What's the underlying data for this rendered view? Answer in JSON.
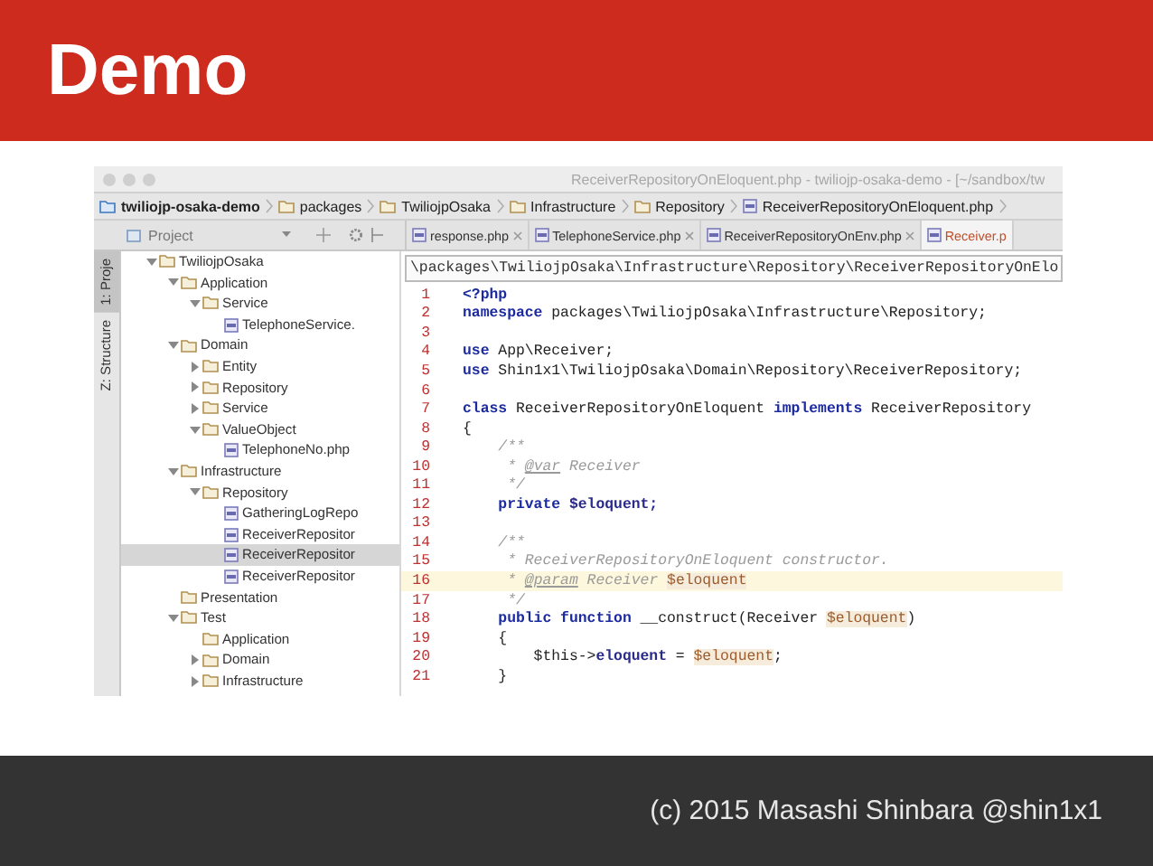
{
  "slide": {
    "title": "Demo",
    "footer": "(c) 2015 Masashi Shinbara @shin1x1"
  },
  "ide": {
    "window_title": "ReceiverRepositoryOnEloquent.php - twiliojp-osaka-demo - [~/sandbox/tw",
    "breadcrumbs": [
      {
        "label": "twiliojp-osaka-demo",
        "kind": "project"
      },
      {
        "label": "packages",
        "kind": "folder"
      },
      {
        "label": "TwiliojpOsaka",
        "kind": "folder"
      },
      {
        "label": "Infrastructure",
        "kind": "folder"
      },
      {
        "label": "Repository",
        "kind": "folder"
      },
      {
        "label": "ReceiverRepositoryOnEloquent.php",
        "kind": "file"
      }
    ],
    "project_panel": {
      "label": "Project"
    },
    "tool_tabs": [
      {
        "label": "1: Proje",
        "selected": true
      },
      {
        "label": "Z: Structure",
        "selected": false
      }
    ],
    "editor_tabs": [
      {
        "label": "response.php",
        "selected": false
      },
      {
        "label": "TelephoneService.php",
        "selected": false
      },
      {
        "label": "ReceiverRepositoryOnEnv.php",
        "selected": false
      },
      {
        "label": "Receiver.p",
        "selected": true
      }
    ],
    "path": "\\packages\\TwiliojpOsaka\\Infrastructure\\Repository\\ReceiverRepositoryOnElo",
    "tree": [
      {
        "label": "TwiliojpOsaka",
        "kind": "folder",
        "expanded": true,
        "selected": false,
        "children": [
          {
            "label": "Application",
            "kind": "folder",
            "expanded": true,
            "selected": false,
            "children": [
              {
                "label": "Service",
                "kind": "folder",
                "expanded": true,
                "selected": false,
                "children": [
                  {
                    "label": "TelephoneService.",
                    "kind": "file",
                    "selected": false
                  }
                ]
              }
            ]
          },
          {
            "label": "Domain",
            "kind": "folder",
            "expanded": true,
            "selected": false,
            "children": [
              {
                "label": "Entity",
                "kind": "folder",
                "expanded": false,
                "selected": false
              },
              {
                "label": "Repository",
                "kind": "folder",
                "expanded": false,
                "selected": false
              },
              {
                "label": "Service",
                "kind": "folder",
                "expanded": false,
                "selected": false
              },
              {
                "label": "ValueObject",
                "kind": "folder",
                "expanded": true,
                "selected": false,
                "children": [
                  {
                    "label": "TelephoneNo.php",
                    "kind": "file",
                    "selected": false
                  }
                ]
              }
            ]
          },
          {
            "label": "Infrastructure",
            "kind": "folder",
            "expanded": true,
            "selected": false,
            "children": [
              {
                "label": "Repository",
                "kind": "folder",
                "expanded": true,
                "selected": false,
                "children": [
                  {
                    "label": "GatheringLogRepo",
                    "kind": "file",
                    "selected": false
                  },
                  {
                    "label": "ReceiverRepositor",
                    "kind": "file",
                    "selected": false
                  },
                  {
                    "label": "ReceiverRepositor",
                    "kind": "file",
                    "selected": true
                  },
                  {
                    "label": "ReceiverRepositor",
                    "kind": "file",
                    "selected": false
                  }
                ]
              }
            ]
          },
          {
            "label": "Presentation",
            "kind": "folder",
            "selected": false
          },
          {
            "label": "Test",
            "kind": "folder",
            "expanded": true,
            "selected": false,
            "children": [
              {
                "label": "Application",
                "kind": "folder",
                "selected": false
              },
              {
                "label": "Domain",
                "kind": "folder",
                "expanded": false,
                "selected": false
              },
              {
                "label": "Infrastructure",
                "kind": "folder",
                "expanded": false,
                "selected": false
              }
            ]
          }
        ]
      }
    ],
    "code": [
      {
        "number": "1",
        "current": false,
        "tokens": [
          {
            "kind": "tag",
            "text": "<?php"
          }
        ]
      },
      {
        "number": "2",
        "current": false,
        "tokens": [
          {
            "kind": "keyword",
            "text": "namespace"
          },
          {
            "kind": "plain",
            "text": " packages\\TwiliojpOsaka\\Infrastructure\\Repository;"
          }
        ]
      },
      {
        "number": "3",
        "current": false
      },
      {
        "number": "4",
        "current": false,
        "tokens": [
          {
            "kind": "keyword",
            "text": "use"
          },
          {
            "kind": "plain",
            "text": " App\\Receiver;"
          }
        ]
      },
      {
        "number": "5",
        "current": false,
        "tokens": [
          {
            "kind": "keyword",
            "text": "use"
          },
          {
            "kind": "plain",
            "text": " Shin1x1\\TwiliojpOsaka\\Domain\\Repository\\ReceiverRepository;"
          }
        ]
      },
      {
        "number": "6",
        "current": false
      },
      {
        "number": "7",
        "current": false,
        "tokens": [
          {
            "kind": "keyword",
            "text": "class"
          },
          {
            "kind": "plain",
            "text": " ReceiverRepositoryOnEloquent "
          },
          {
            "kind": "keyword",
            "text": "implements"
          },
          {
            "kind": "plain",
            "text": " ReceiverRepository"
          }
        ]
      },
      {
        "number": "8",
        "current": false,
        "tokens": [
          {
            "kind": "plain",
            "text": "{"
          }
        ]
      },
      {
        "number": "9",
        "current": false,
        "tokens": [
          {
            "kind": "comment",
            "text": "    /**"
          }
        ]
      },
      {
        "number": "10",
        "current": false,
        "tokens": [
          {
            "kind": "comment",
            "text": "     * "
          },
          {
            "kind": "doctag",
            "text": "@var"
          },
          {
            "kind": "comment",
            "text": " Receiver"
          }
        ]
      },
      {
        "number": "11",
        "current": false,
        "tokens": [
          {
            "kind": "comment",
            "text": "     */"
          }
        ]
      },
      {
        "number": "12",
        "current": false,
        "tokens": [
          {
            "kind": "keyword",
            "text": "    private"
          },
          {
            "kind": "field",
            "text": " $eloquent;"
          }
        ]
      },
      {
        "number": "13",
        "current": false
      },
      {
        "number": "14",
        "current": false,
        "tokens": [
          {
            "kind": "comment",
            "text": "    /**"
          }
        ]
      },
      {
        "number": "15",
        "current": false,
        "tokens": [
          {
            "kind": "comment",
            "text": "     * ReceiverRepositoryOnEloquent constructor."
          }
        ]
      },
      {
        "number": "16",
        "current": true,
        "tokens": [
          {
            "kind": "comment",
            "text": "     * "
          },
          {
            "kind": "doctag",
            "text": "@param"
          },
          {
            "kind": "comment",
            "text": " Receiver "
          },
          {
            "kind": "variable",
            "text": "$eloquent"
          }
        ]
      },
      {
        "number": "17",
        "current": false,
        "tokens": [
          {
            "kind": "comment",
            "text": "     */"
          }
        ]
      },
      {
        "number": "18",
        "current": false,
        "tokens": [
          {
            "kind": "keyword",
            "text": "    public function"
          },
          {
            "kind": "plain",
            "text": " __construct(Receiver "
          },
          {
            "kind": "variable",
            "text": "$eloquent"
          },
          {
            "kind": "plain",
            "text": ")"
          }
        ]
      },
      {
        "number": "19",
        "current": false,
        "tokens": [
          {
            "kind": "plain",
            "text": "    {"
          }
        ]
      },
      {
        "number": "20",
        "current": false,
        "tokens": [
          {
            "kind": "plain",
            "text": "        $this->"
          },
          {
            "kind": "field",
            "text": "eloquent"
          },
          {
            "kind": "plain",
            "text": " = "
          },
          {
            "kind": "variable",
            "text": "$eloquent"
          },
          {
            "kind": "plain",
            "text": ";"
          }
        ]
      },
      {
        "number": "21",
        "current": false,
        "tokens": [
          {
            "kind": "plain",
            "text": "    }"
          }
        ]
      }
    ]
  }
}
